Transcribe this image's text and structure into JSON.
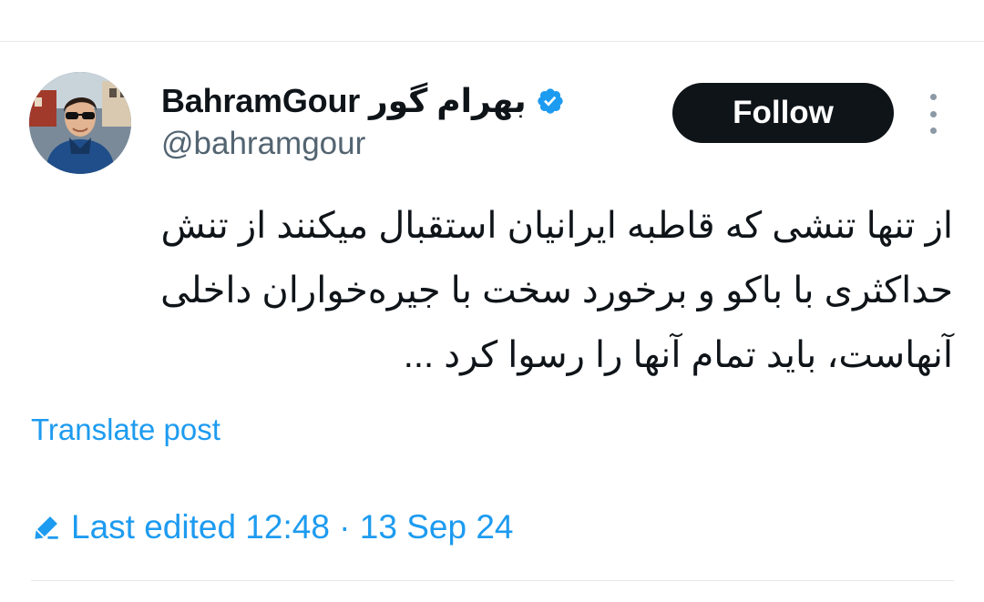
{
  "post": {
    "author": {
      "display_name": "BahramGour",
      "display_name_fa": "بهرام گور",
      "handle": "@bahramgour",
      "verified": true,
      "avatar_icon": "profile-photo"
    },
    "follow_label": "Follow",
    "more_icon": "vertical-ellipsis-icon",
    "text_lines": [
      "از تنها تنشی که قاطبه ایرانیان استقبال میکنند از تنش",
      "حداکثری با باکو و برخورد سخت با جیره‌خواران داخلی",
      "آنهاست، باید تمام آنها را رسوا کرد ..."
    ],
    "translate_label": "Translate post",
    "edited_label": "Last edited 12:48 · 13 Sep 24"
  },
  "colors": {
    "accent": "#1d9bf0",
    "text": "#0f1419",
    "secondary_text": "#536471",
    "follow_bg": "#0f1419",
    "divider": "#e6e8ea"
  }
}
